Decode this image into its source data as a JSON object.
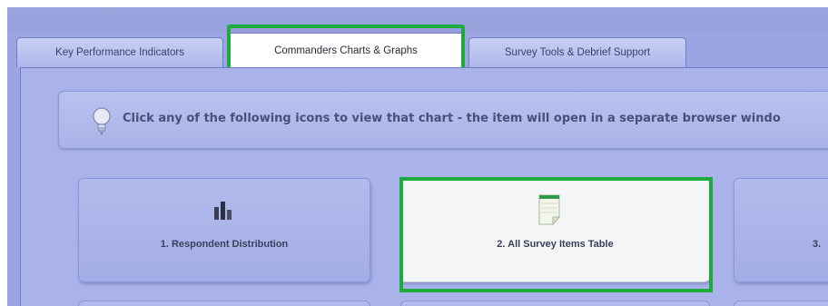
{
  "tabs": [
    {
      "label": "Key Performance Indicators",
      "active": false
    },
    {
      "label": "Commanders Charts & Graphs",
      "active": true
    },
    {
      "label": "Survey Tools & Debrief Support",
      "active": false
    }
  ],
  "info": {
    "text": "Click any of the following icons to view that chart - the item will open in a separate browser windo",
    "icon": "lightbulb-icon"
  },
  "tiles": [
    {
      "label": "1. Respondent Distribution",
      "icon": "bar-chart-icon",
      "selected": false
    },
    {
      "label": "2. All Survey Items Table",
      "icon": "spreadsheet-doc-icon",
      "selected": true
    },
    {
      "label": "3. ",
      "icon": "",
      "selected": false
    }
  ],
  "colors": {
    "background": "#9aa5e2",
    "highlight": "#1eaa3c",
    "selected_tile": "#f4f5f6"
  }
}
